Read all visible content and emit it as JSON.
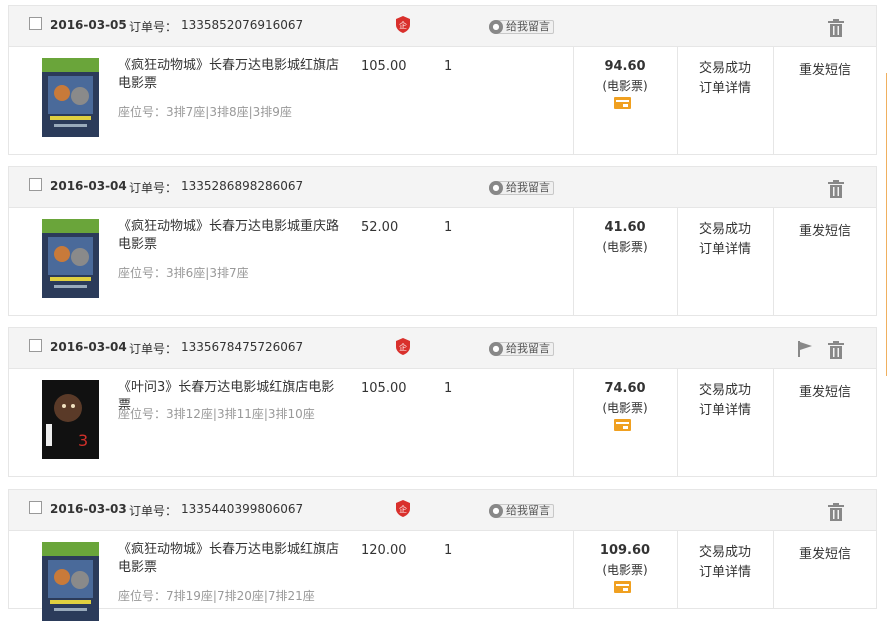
{
  "order_label": "订单号：",
  "message_label": "给我留言",
  "resend_label": "重发短信",
  "status_label": "交易成功",
  "detail_label": "订单详情",
  "ticket_type": "(电影票)",
  "colors": {
    "accent": "#d9302c",
    "pay": "#f0a020",
    "header_bg": "#f4f4f4"
  },
  "icons": [
    "checkbox",
    "shield-icon",
    "message-icon",
    "trash-icon",
    "flag-icon",
    "pay-card-icon"
  ],
  "orders": [
    {
      "date": "2016-03-05",
      "order_no": "1335852076916067",
      "title": "《疯狂动物城》长春万达电影城红旗店电影票",
      "seats": "座位号：3排7座|3排8座|3排9座",
      "price": "105.00",
      "qty": "1",
      "total": "94.60",
      "has_shield": true,
      "has_flag": false,
      "has_pay_icon": true,
      "poster": "zootopia"
    },
    {
      "date": "2016-03-04",
      "order_no": "1335286898286067",
      "title": "《疯狂动物城》长春万达电影城重庆路电影票",
      "seats": "座位号：3排6座|3排7座",
      "price": "52.00",
      "qty": "1",
      "total": "41.60",
      "has_shield": false,
      "has_flag": false,
      "has_pay_icon": false,
      "poster": "zootopia"
    },
    {
      "date": "2016-03-04",
      "order_no": "1335678475726067",
      "title": "《叶问3》长春万达电影城红旗店电影票",
      "seats": "座位号：3排12座|3排11座|3排10座",
      "price": "105.00",
      "qty": "1",
      "total": "74.60",
      "has_shield": true,
      "has_flag": true,
      "has_pay_icon": true,
      "poster": "ipman"
    },
    {
      "date": "2016-03-03",
      "order_no": "1335440399806067",
      "title": "《疯狂动物城》长春万达电影城红旗店电影票",
      "seats": "座位号：7排19座|7排20座|7排21座",
      "price": "120.00",
      "qty": "1",
      "total": "109.60",
      "has_shield": true,
      "has_flag": false,
      "has_pay_icon": true,
      "poster": "zootopia"
    }
  ]
}
